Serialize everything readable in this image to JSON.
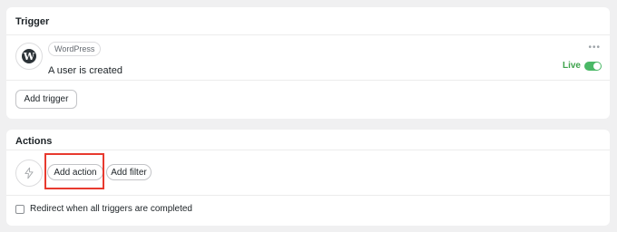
{
  "trigger": {
    "title": "Trigger",
    "app_badge": "WordPress",
    "event": "A user is created",
    "more_icon_text": "•••",
    "status": "Live",
    "add_trigger_label": "Add trigger",
    "app_icon": "wordpress-icon",
    "logo_letter": "W"
  },
  "actions": {
    "title": "Actions",
    "action_icon": "lightning-icon",
    "add_action_label": "Add action",
    "add_filter_label": "Add filter",
    "redirect_label": "Redirect when all triggers are completed"
  },
  "colors": {
    "live": "#3fa34d",
    "toggle_on": "#4ab866",
    "highlight": "#e83a2f"
  }
}
